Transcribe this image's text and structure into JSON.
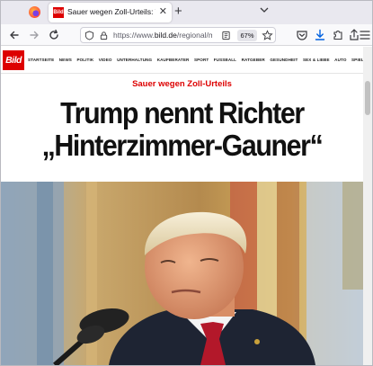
{
  "browser": {
    "tab_title": "Sauer wegen Zoll-Urteils: Trump",
    "tab_close": "✕",
    "new_tab": "+",
    "url_prefix": "https://www.",
    "url_domain": "bild.de",
    "url_path": "/regional/m",
    "zoom": "67%",
    "favicon_text": "Bild"
  },
  "site": {
    "logo": "Bild",
    "nav": [
      "STARTSEITE",
      "NEWS",
      "POLITIK",
      "VIDEO",
      "UNTERHALTUNG",
      "KAUFBERATER",
      "SPORT",
      "FUSSBALL",
      "RATGEBER",
      "GESUNDHEIT",
      "SEX & LIEBE",
      "AUTO",
      "SPIELE"
    ]
  },
  "article": {
    "kicker": "Sauer wegen Zoll-Urteils",
    "headline_line1": "Trump nennt Richter",
    "headline_line2": "„Hinterzimmer-Gauner“"
  },
  "colors": {
    "brand_red": "#dd0000",
    "tab_strip": "#e9e8ef",
    "nav_bar": "#f9f9fb"
  },
  "icons": [
    "firefox-logo-icon",
    "back-icon",
    "forward-icon",
    "reload-icon",
    "shield-icon",
    "lock-icon",
    "reader-view-icon",
    "bookmark-star-icon",
    "pocket-icon",
    "downloads-icon",
    "extensions-icon",
    "share-icon",
    "menu-icon",
    "tab-list-icon"
  ]
}
